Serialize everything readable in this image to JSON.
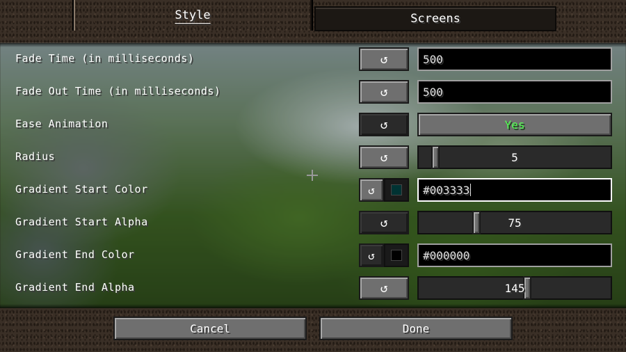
{
  "tabs": [
    {
      "label": "Style",
      "active": true
    },
    {
      "label": "Screens",
      "active": false
    }
  ],
  "reset_icon": "reset-arrow-icon",
  "rows": [
    {
      "label": "Fade Time (in milliseconds)",
      "type": "text",
      "value": "500"
    },
    {
      "label": "Fade Out Time (in milliseconds)",
      "type": "text",
      "value": "500"
    },
    {
      "label": "Ease Animation",
      "type": "toggle",
      "value": "Yes"
    },
    {
      "label": "Radius",
      "type": "slider",
      "value": "5",
      "level": 0.07
    },
    {
      "label": "Gradient Start Color",
      "type": "color",
      "value": "#003333",
      "swatch": "#003333"
    },
    {
      "label": "Gradient Start Alpha",
      "type": "slider",
      "value": "75",
      "level": 0.29
    },
    {
      "label": "Gradient End Color",
      "type": "color",
      "value": "#000000",
      "swatch": "#000000"
    },
    {
      "label": "Gradient End Alpha",
      "type": "slider",
      "value": "145",
      "level": 0.57
    }
  ],
  "footer": {
    "cancel": "Cancel",
    "done": "Done"
  },
  "colors": {
    "toggle_on": "#55ff55"
  }
}
